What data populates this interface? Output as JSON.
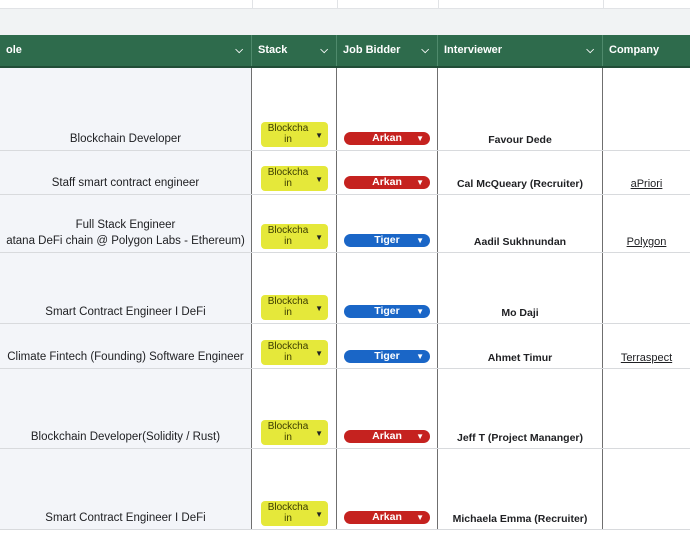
{
  "colors": {
    "header_bg": "#2e6b4c",
    "stack_chip": "#e5e83a",
    "bidder_arkan": "#c5221f",
    "bidder_tiger": "#1a66c7"
  },
  "header": {
    "role": "ole",
    "stack": "Stack",
    "bidder": "Job Bidder",
    "interviewer": "Interviewer",
    "company": "Company"
  },
  "rows": [
    {
      "role_lines": [
        "Blockchain Developer"
      ],
      "stack_lines": [
        "Blockcha",
        "in"
      ],
      "bidder": "Arkan",
      "interviewer": "Favour Dede",
      "company": ""
    },
    {
      "role_lines": [
        "Staff smart contract engineer"
      ],
      "stack_lines": [
        "Blockcha",
        "in"
      ],
      "bidder": "Arkan",
      "interviewer": "Cal McQueary (Recruiter)",
      "company": "aPriori"
    },
    {
      "role_lines": [
        "Full Stack Engineer",
        "atana DeFi chain @ Polygon Labs - Ethereum)"
      ],
      "stack_lines": [
        "Blockcha",
        "in"
      ],
      "bidder": "Tiger",
      "interviewer": "Aadil Sukhnundan",
      "company": "Polygon"
    },
    {
      "role_lines": [
        "Smart Contract Engineer I DeFi"
      ],
      "stack_lines": [
        "Blockcha",
        "in"
      ],
      "bidder": "Tiger",
      "interviewer": "Mo Daji",
      "company": ""
    },
    {
      "role_lines": [
        "Climate Fintech (Founding) Software Engineer"
      ],
      "stack_lines": [
        "Blockcha",
        "in"
      ],
      "bidder": "Tiger",
      "interviewer": "Ahmet Timur",
      "company": "Terraspect"
    },
    {
      "role_lines": [
        "Blockchain Developer(Solidity / Rust)"
      ],
      "stack_lines": [
        "Blockcha",
        "in"
      ],
      "bidder": "Arkan",
      "interviewer": "Jeff T (Project Mananger)",
      "company": ""
    },
    {
      "role_lines": [
        "Smart Contract Engineer I DeFi"
      ],
      "stack_lines": [
        "Blockcha",
        "in"
      ],
      "bidder": "Arkan",
      "interviewer": "Michaela Emma (Recruiter)",
      "company": ""
    }
  ]
}
